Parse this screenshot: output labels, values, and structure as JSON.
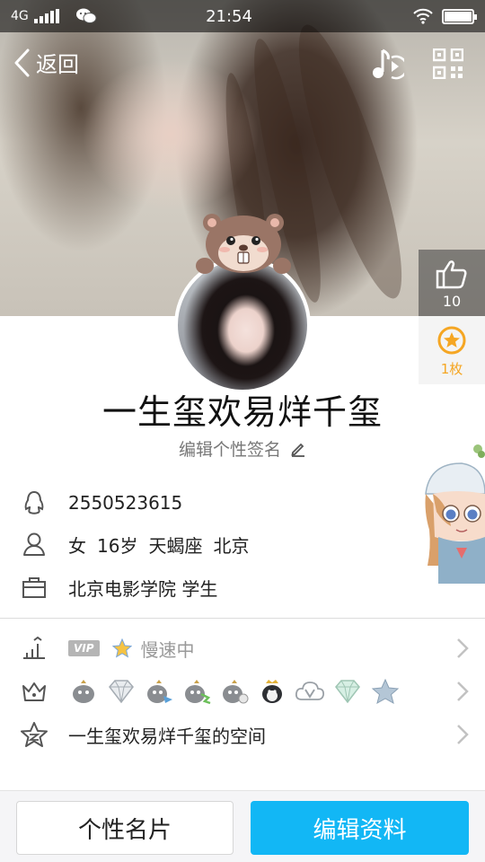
{
  "status_bar": {
    "network": "4G",
    "time": "21:54"
  },
  "nav": {
    "back_label": "返回",
    "icons": [
      "music-icon",
      "qr-code-icon"
    ]
  },
  "likes": {
    "count": "10"
  },
  "badge_panel": {
    "count": "1枚"
  },
  "profile": {
    "name": "一生玺欢易烊千玺",
    "signature_placeholder": "编辑个性签名"
  },
  "info": {
    "qq_number": "2550523615",
    "gender": "女",
    "age": "16岁",
    "zodiac": "天蝎座",
    "city": "北京",
    "school": "北京电影学院 学生"
  },
  "list": {
    "vip_label": "VIP",
    "speed_label": "慢速中",
    "space_label": "一生玺欢易烊千玺的空间"
  },
  "bottom": {
    "card_button": "个性名片",
    "edit_button": "编辑资料"
  },
  "colors": {
    "accent": "#12b7f5",
    "badge_gold": "#f5a623"
  }
}
